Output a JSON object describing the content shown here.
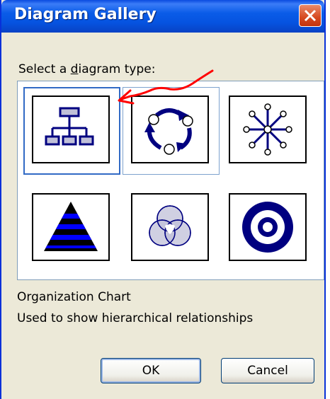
{
  "window": {
    "title": "Diagram Gallery"
  },
  "prompt": {
    "before": "Select a ",
    "accel": "d",
    "after": "iagram type:"
  },
  "gallery": {
    "selected": "Organization Chart",
    "items": [
      {
        "icon": "organization-chart-icon"
      },
      {
        "icon": "cycle-diagram-icon"
      },
      {
        "icon": "radial-diagram-icon"
      },
      {
        "icon": "pyramid-diagram-icon"
      },
      {
        "icon": "venn-diagram-icon"
      },
      {
        "icon": "target-diagram-icon"
      }
    ]
  },
  "description": {
    "title": "Organization Chart",
    "text": "Used to show hierarchical relationships"
  },
  "buttons": {
    "ok": "OK",
    "cancel": "Cancel"
  },
  "colors": {
    "accent": "#000080",
    "fill": "#c0c0d8",
    "annotation": "#ff0000"
  }
}
